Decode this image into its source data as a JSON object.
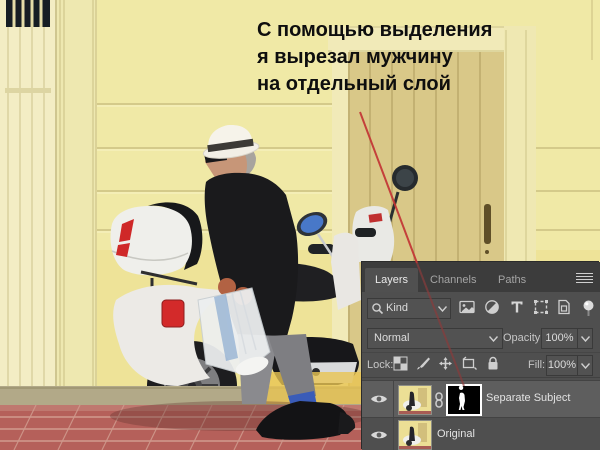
{
  "annotation": {
    "line1": "С помощью выделения",
    "line2": "я вырезал мужчину",
    "line3": "на отдельный слой"
  },
  "panel": {
    "tabs": {
      "layers": "Layers",
      "channels": "Channels",
      "paths": "Paths"
    },
    "filter_bar": {
      "search_label": "Kind"
    },
    "blend_bar": {
      "mode": "Normal",
      "opacity_label": "Opacity:",
      "opacity_value": "100%"
    },
    "lock_bar": {
      "lock_label": "Lock:",
      "fill_label": "Fill:",
      "fill_value": "100%"
    },
    "layers": [
      {
        "name": "Separate Subject",
        "selected": true,
        "visible": true,
        "linked": true,
        "has_mask": true
      },
      {
        "name": "Original",
        "selected": false,
        "visible": true
      }
    ],
    "icon_names": [
      "panel-menu-icon",
      "search-icon",
      "chevron-down-icon",
      "pixel-filter-icon",
      "adjustment-filter-icon",
      "type-filter-icon",
      "shape-filter-icon",
      "smart-object-filter-icon",
      "filter-pin-icon",
      "lock-transparency-icon",
      "lock-paint-icon",
      "lock-position-icon",
      "lock-artboard-icon",
      "lock-all-icon",
      "eye-icon",
      "link-icon",
      "layer-thumbnail",
      "mask-thumbnail"
    ]
  },
  "colors": {
    "annotation_text": "#0e0e0e",
    "arrow_red": "#c23434",
    "wall_yellow": "#f0e9a6",
    "door_tan": "#d9c888",
    "pavement_red": "#b5605a",
    "sock_blue": "#3a5cb8",
    "scooter_white": "#ebebe7",
    "panel_bg": "#4f4f4f",
    "panel_tab_bg": "#3c3c3c",
    "selected_row_bg": "#5e5e5e"
  }
}
